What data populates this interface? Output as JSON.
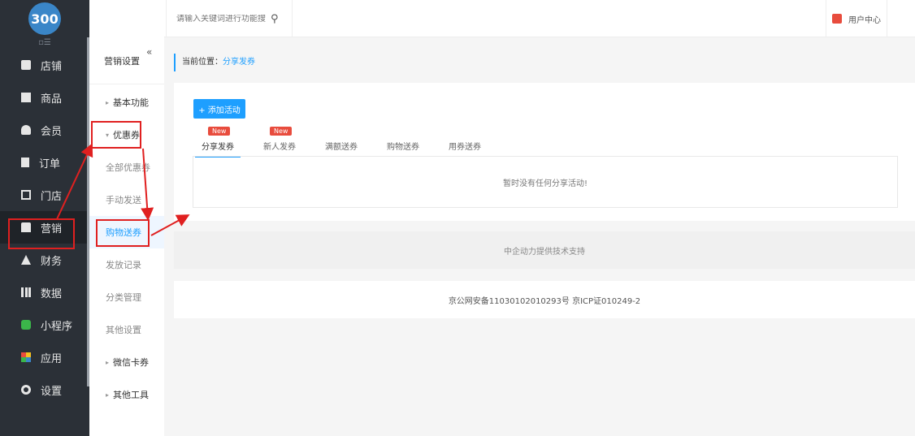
{
  "logo": {
    "text": "300"
  },
  "sidebar": {
    "fold_icon": "fold-icon",
    "items": [
      {
        "label": "店铺",
        "icon": "store-icon"
      },
      {
        "label": "商品",
        "icon": "goods-icon"
      },
      {
        "label": "会员",
        "icon": "member-icon"
      },
      {
        "label": "订单",
        "icon": "order-icon"
      },
      {
        "label": "门店",
        "icon": "shop-icon"
      },
      {
        "label": "营销",
        "icon": "marketing-icon"
      },
      {
        "label": "财务",
        "icon": "finance-icon"
      },
      {
        "label": "数据",
        "icon": "data-icon"
      },
      {
        "label": "小程序",
        "icon": "miniapp-icon"
      },
      {
        "label": "应用",
        "icon": "apps-icon"
      },
      {
        "label": "设置",
        "icon": "settings-icon"
      }
    ]
  },
  "subnav": {
    "title": "营销设置",
    "items": [
      {
        "label": "基本功能"
      },
      {
        "label": "优惠券"
      },
      {
        "label": "全部优惠券"
      },
      {
        "label": "手动发送"
      },
      {
        "label": "购物送券"
      },
      {
        "label": "发放记录"
      },
      {
        "label": "分类管理"
      },
      {
        "label": "其他设置"
      },
      {
        "label": "微信卡券"
      },
      {
        "label": "其他工具"
      }
    ]
  },
  "topbar": {
    "search_placeholder": "请输入关键词进行功能搜",
    "user_center": "用户中心"
  },
  "breadcrumb": {
    "prefix": "当前位置：",
    "current": "分享发券"
  },
  "main": {
    "add_button": "+ 添加活动",
    "tabs": [
      {
        "label": "分享发券",
        "badge": "New"
      },
      {
        "label": "新人发券",
        "badge": "New"
      },
      {
        "label": "满额送券",
        "badge": ""
      },
      {
        "label": "购物送券",
        "badge": ""
      },
      {
        "label": "用券送券",
        "badge": ""
      }
    ],
    "empty_text": "暂时没有任何分享活动!"
  },
  "footer": {
    "support": "中企动力提供技术支持",
    "icp": "京公网安备11030102010293号 京ICP证010249-2"
  },
  "colors": {
    "accent": "#1e9fff",
    "badge": "#e84c3d",
    "annotation": "#e02020",
    "sidebar": "#2b3037"
  }
}
